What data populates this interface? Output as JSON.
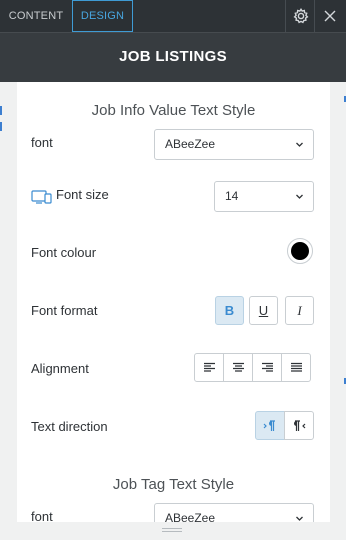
{
  "topbar": {
    "tabs": [
      {
        "label": "CONTENT",
        "active": false
      },
      {
        "label": "DESIGN",
        "active": true
      }
    ],
    "icons": [
      "gear-icon",
      "close-icon"
    ]
  },
  "title": "JOB LISTINGS",
  "sections": {
    "job_info": {
      "title": "Job Info Value Text Style",
      "font_label": "font",
      "font_value": "ABeeZee",
      "font_size_label": "Font size",
      "font_size_value": "14",
      "font_colour_label": "Font colour",
      "font_colour_value": "#000000",
      "font_format_label": "Font format",
      "format_buttons": [
        "B",
        "U",
        "I"
      ],
      "format_active": "B",
      "alignment_label": "Alignment",
      "alignment_options": [
        "align-left",
        "align-center",
        "align-right",
        "align-justify"
      ],
      "text_direction_label": "Text direction",
      "direction_options": [
        "ltr",
        "rtl"
      ],
      "direction_active": "ltr"
    },
    "job_tag": {
      "title": "Job Tag Text Style",
      "font_label": "font",
      "font_value": "ABeeZee"
    }
  },
  "colors": {
    "accent": "#48a6e0",
    "topbar_bg": "#2d3236",
    "titlebar_bg": "#373c40",
    "active_btn_bg": "#dbe9f3"
  }
}
